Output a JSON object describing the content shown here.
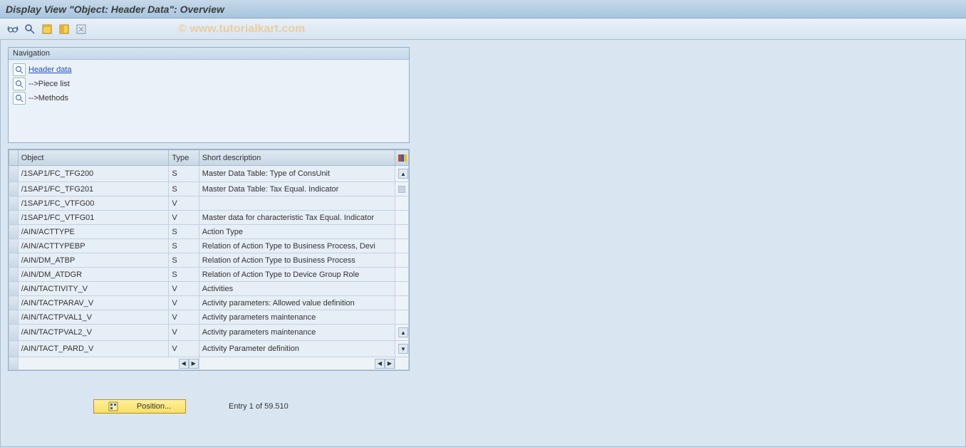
{
  "title": "Display View \"Object: Header Data\": Overview",
  "watermark": "© www.tutorialkart.com",
  "navigation": {
    "label": "Navigation",
    "items": [
      {
        "label": "Header data",
        "active": true
      },
      {
        "label": "-->Piece list",
        "active": false
      },
      {
        "label": "-->Methods",
        "active": false
      }
    ]
  },
  "table": {
    "columns": [
      "Object",
      "Type",
      "Short description"
    ],
    "rows": [
      {
        "object": "/1SAP1/FC_TFG200",
        "type": "S",
        "desc": "Master Data Table: Type of ConsUnit"
      },
      {
        "object": "/1SAP1/FC_TFG201",
        "type": "S",
        "desc": "Master Data Table: Tax Equal. Indicator"
      },
      {
        "object": "/1SAP1/FC_VTFG00",
        "type": "V",
        "desc": ""
      },
      {
        "object": "/1SAP1/FC_VTFG01",
        "type": "V",
        "desc": "Master data for characteristic Tax Equal. Indicator"
      },
      {
        "object": "/AIN/ACTTYPE",
        "type": "S",
        "desc": "Action Type"
      },
      {
        "object": "/AIN/ACTTYPEBP",
        "type": "S",
        "desc": "Relation of Action Type to Business Process, Devi"
      },
      {
        "object": "/AIN/DM_ATBP",
        "type": "S",
        "desc": "Relation of Action Type to Business Process"
      },
      {
        "object": "/AIN/DM_ATDGR",
        "type": "S",
        "desc": "Relation of Action Type to Device Group Role"
      },
      {
        "object": "/AIN/TACTIVITY_V",
        "type": "V",
        "desc": "Activities"
      },
      {
        "object": "/AIN/TACTPARAV_V",
        "type": "V",
        "desc": "Activity parameters: Allowed value definition"
      },
      {
        "object": "/AIN/TACTPVAL1_V",
        "type": "V",
        "desc": "Activity parameters maintenance"
      },
      {
        "object": "/AIN/TACTPVAL2_V",
        "type": "V",
        "desc": "Activity parameters maintenance"
      },
      {
        "object": "/AIN/TACT_PARD_V",
        "type": "V",
        "desc": "Activity Parameter definition"
      }
    ]
  },
  "footer": {
    "position_label": "Position...",
    "entry_text": "Entry 1 of 59.510"
  }
}
